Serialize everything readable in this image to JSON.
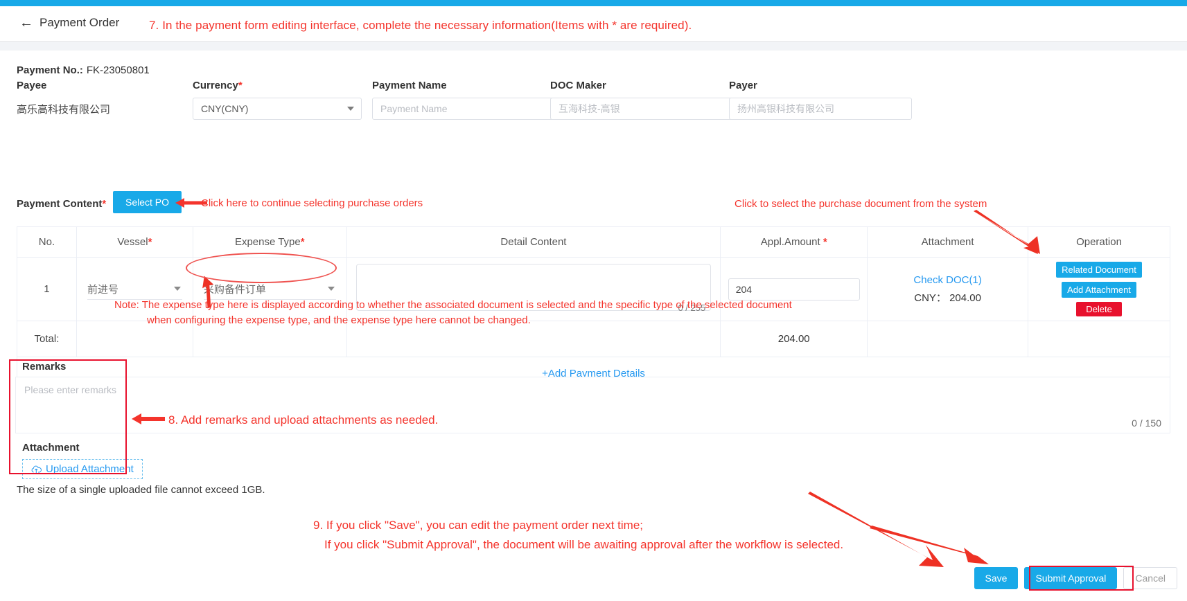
{
  "header": {
    "back_label": "Payment Order",
    "back_icon": "arrow-left-icon",
    "annotation_7": "7. In the payment form editing interface, complete the necessary information(Items with * are required)."
  },
  "form": {
    "payment_no_label": "Payment No.:",
    "payment_no_value": "FK-23050801",
    "fields": [
      {
        "label": "Payee",
        "required": false,
        "type": "static",
        "value": "高乐高科技有限公司"
      },
      {
        "label": "Currency",
        "required": true,
        "type": "select",
        "value": "CNY(CNY)"
      },
      {
        "label": "Payment Name",
        "required": false,
        "type": "input",
        "value": "",
        "placeholder": "Payment Name"
      },
      {
        "label": "DOC Maker",
        "required": false,
        "type": "input",
        "value": "",
        "placeholder": "互海科技-高银"
      },
      {
        "label": "Payer",
        "required": false,
        "type": "input",
        "value": "",
        "placeholder": "扬州高银科技有限公司"
      }
    ],
    "payment_content_label": "Payment Content",
    "payment_content_required": true,
    "select_po_label": "Select PO",
    "select_po_annotation": "Click here to continue selecting purchase orders"
  },
  "table": {
    "columns": [
      {
        "label": "No.",
        "required": false
      },
      {
        "label": "Vessel",
        "required": true
      },
      {
        "label": "Expense Type",
        "required": true
      },
      {
        "label": "Detail Content",
        "required": false
      },
      {
        "label": "Appl.Amount ",
        "required": true
      },
      {
        "label": "Attachment",
        "required": false
      },
      {
        "label": "Operation",
        "required": false
      }
    ],
    "rows": [
      {
        "no": "1",
        "vessel": "前进号",
        "expense_type": "采购备件订单",
        "detail_content": "",
        "detail_counter": "0 / 255",
        "appl_amount": "204",
        "attachment_link": "Check DOC(1)",
        "attachment_amount": "CNY： 204.00",
        "ops": [
          {
            "label": "Related Document",
            "style": "blue"
          },
          {
            "label": "Add Attachment",
            "style": "blue"
          },
          {
            "label": "Delete",
            "style": "red"
          }
        ]
      }
    ],
    "total_label": "Total:",
    "total_amount": "204.00",
    "add_payment_details": "+Add Payment Details",
    "note_line1": "Note: The expense type here is displayed according to whether the associated document is selected and the specific type of the selected document",
    "note_line2": "when configuring the expense type, and the expense type here cannot be changed.",
    "related_doc_annotation": "Click to select the purchase document from the system"
  },
  "remarks": {
    "title": "Remarks",
    "placeholder": "Please enter remarks",
    "value": "",
    "counter": "0 / 150",
    "attachment_title": "Attachment",
    "upload_label": "Upload Attachment",
    "upload_icon": "cloud-upload-icon",
    "upload_hint": "The size of a single uploaded file cannot exceed 1GB.",
    "annotation_8": "8. Add remarks and upload attachments as needed."
  },
  "footer": {
    "annotation_9_line1": "9. If you click \"Save\", you can edit the payment order next time;",
    "annotation_9_line2": "If you click \"Submit Approval\", the document will be awaiting approval after the workflow is selected.",
    "save_label": "Save",
    "submit_label": "Submit Approval",
    "cancel_label": "Cancel"
  },
  "colors": {
    "accent": "#18a9e8",
    "danger": "#e8112d",
    "annotation": "#f4342c",
    "link": "#2699f0"
  }
}
